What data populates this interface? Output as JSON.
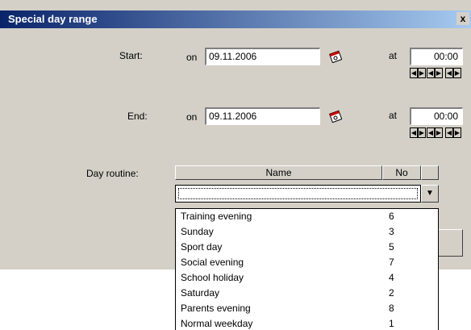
{
  "dialog": {
    "title": "Special day range",
    "close_label": "x"
  },
  "start": {
    "label": "Start:",
    "on_label": "on",
    "date": "09.11.2006",
    "at_label": "at",
    "time": "00:00"
  },
  "end": {
    "label": "End:",
    "on_label": "on",
    "date": "09.11.2006",
    "at_label": "at",
    "time": "00:00"
  },
  "routine": {
    "label": "Day routine:",
    "columns": [
      "Name",
      "No"
    ],
    "selected": "",
    "items": [
      {
        "name": "Training evening",
        "no": "6"
      },
      {
        "name": "Sunday",
        "no": "3"
      },
      {
        "name": "Sport day",
        "no": "5"
      },
      {
        "name": "Social evening",
        "no": "7"
      },
      {
        "name": "School holiday",
        "no": "4"
      },
      {
        "name": "Saturday",
        "no": "2"
      },
      {
        "name": "Parents evening",
        "no": "8"
      },
      {
        "name": "Normal weekday",
        "no": "1"
      }
    ]
  }
}
